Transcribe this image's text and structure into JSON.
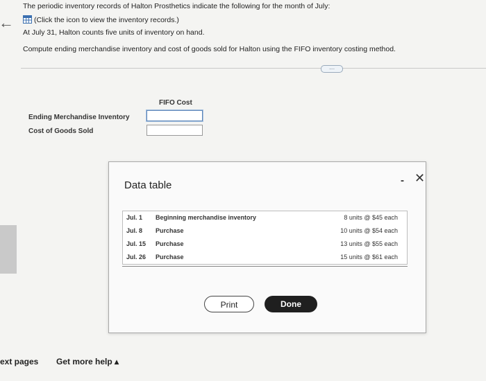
{
  "question": {
    "line1": "The periodic inventory records of Halton Prosthetics indicate the following for the month of July:",
    "line2": "(Click the icon to view the inventory records.)",
    "line3": "At July 31, Halton counts five units of inventory on hand.",
    "line4": "Compute ending merchandise inventory and cost of goods sold for Halton using the FIFO inventory costing method."
  },
  "more_pill": "....",
  "answer_table": {
    "column_header": "FIFO Cost",
    "rows": [
      {
        "label": "Ending Merchandise Inventory",
        "value": ""
      },
      {
        "label": "Cost of Goods Sold",
        "value": ""
      }
    ]
  },
  "modal": {
    "title": "Data table",
    "minimize": "-",
    "close": "✕",
    "rows": [
      {
        "date": "Jul. 1",
        "desc": "Beginning merchandise inventory",
        "qty": "8 units @ $45 each"
      },
      {
        "date": "Jul. 8",
        "desc": "Purchase",
        "qty": "10 units @ $54 each"
      },
      {
        "date": "Jul. 15",
        "desc": "Purchase",
        "qty": "13 units @ $55 each"
      },
      {
        "date": "Jul. 26",
        "desc": "Purchase",
        "qty": "15 units @ $61 each"
      }
    ],
    "print_label": "Print",
    "done_label": "Done"
  },
  "footer": {
    "next_pages": "ext pages",
    "get_more_help": "Get more help ▴"
  }
}
